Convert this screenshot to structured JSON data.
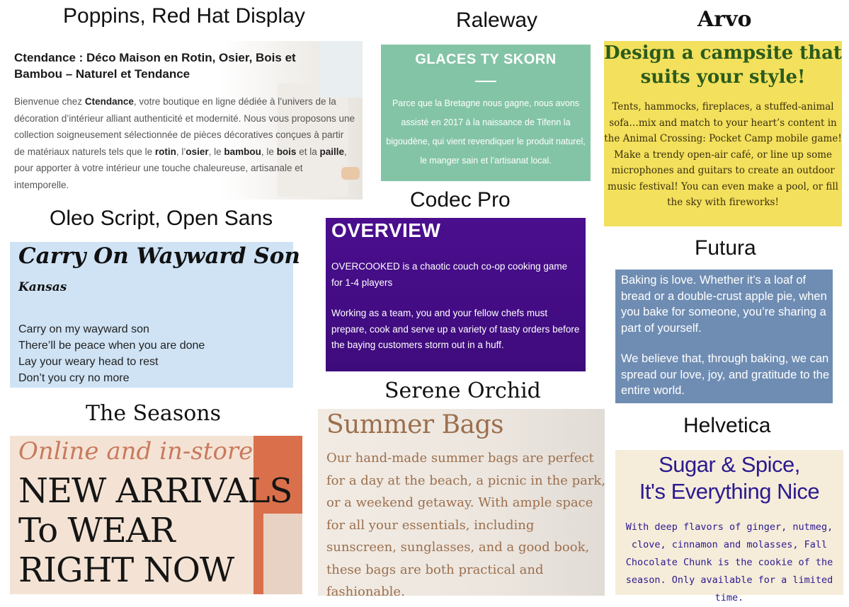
{
  "headings": {
    "poppins": "Poppins, Red Hat Display",
    "raleway": "Raleway",
    "arvo": "Arvo",
    "oleo": "Oleo Script, Open Sans",
    "codec": "Codec Pro",
    "futura": "Futura",
    "seasons": "The Seasons",
    "serene": "Serene Orchid",
    "helvetica": "Helvetica"
  },
  "poppins_panel": {
    "title": "Ctendance : Déco Maison en Rotin, Osier, Bois et Bambou – Naturel et Tendance",
    "body_intro": "Bienvenue chez ",
    "brand": "Ctendance",
    "body_mid": ", votre boutique en ligne dédiée à l’univers de la décoration d’intérieur alliant authenticité et modernité. Nous vous proposons une collection soigneusement sélectionnée de pièces décoratives conçues à partir de matériaux naturels tels que le ",
    "m1": "rotin",
    "sep1": ", l’",
    "m2": "osier",
    "sep2": ", le ",
    "m3": "bambou",
    "sep3": ", le ",
    "m4": "bois",
    "sep4": " et la ",
    "m5": "paille",
    "body_end": ", pour apporter à votre intérieur une touche chaleureuse, artisanale et intemporelle."
  },
  "raleway_panel": {
    "title": "GLACES TY SKORN",
    "body": "Parce que la Bretagne nous gagne, nous avons assisté en 2017 à la naissance de Tifenn la bigoudène, qui vient revendiquer le produit naturel, le manger sain et l’artisanat local."
  },
  "arvo_panel": {
    "title": "Design a campsite that suits your style!",
    "body": "Tents, hammocks, fireplaces, a stuffed-animal sofa…mix and match to your heart’s content in the Animal Crossing: Pocket Camp mobile game! Make a trendy open-air café, or line up some microphones and guitars to create an outdoor music festival! You can even make a pool, or fill the sky with fireworks!"
  },
  "oleo_panel": {
    "title": "Carry On Wayward Son",
    "subtitle": "Kansas",
    "lines": [
      "Carry on my wayward son",
      "There’ll be peace when you are done",
      "Lay your weary head to rest",
      "Don’t you cry no more"
    ]
  },
  "codec_panel": {
    "title": "OVERVIEW",
    "p1": "OVERCOOKED is a chaotic couch co-op cooking game for 1-4 players",
    "p2": "Working as a team, you and your fellow chefs must prepare, cook and serve up a variety of tasty orders before the baying customers storm out in a huff."
  },
  "futura_panel": {
    "p1": "Baking is love. Whether it’s a loaf of bread or a double-crust apple pie, when you bake for someone, you’re sharing a part of yourself.",
    "p2": "We believe that, through baking, we can spread our love, joy, and gratitude to the entire world."
  },
  "seasons_panel": {
    "script": "Online and in-store",
    "lines": [
      "NEW ARRIVALS",
      "To WEAR",
      "RIGHT NOW"
    ]
  },
  "serene_panel": {
    "title": "Summer Bags",
    "body": "Our hand-made summer bags are perfect for a day at the beach, a picnic in the park, or a weekend getaway. With ample space for all your essentials, including sunscreen, sunglasses, and a good book, these bags are both practical and fashionable."
  },
  "helvetica_panel": {
    "title_line1": "Sugar & Spice,",
    "title_line2": "It's Everything Nice",
    "body": "With deep flavors of ginger, nutmeg, clove, cinnamon and molasses, Fall Chocolate Chunk is the cookie of the season. Only available for a limited time."
  }
}
